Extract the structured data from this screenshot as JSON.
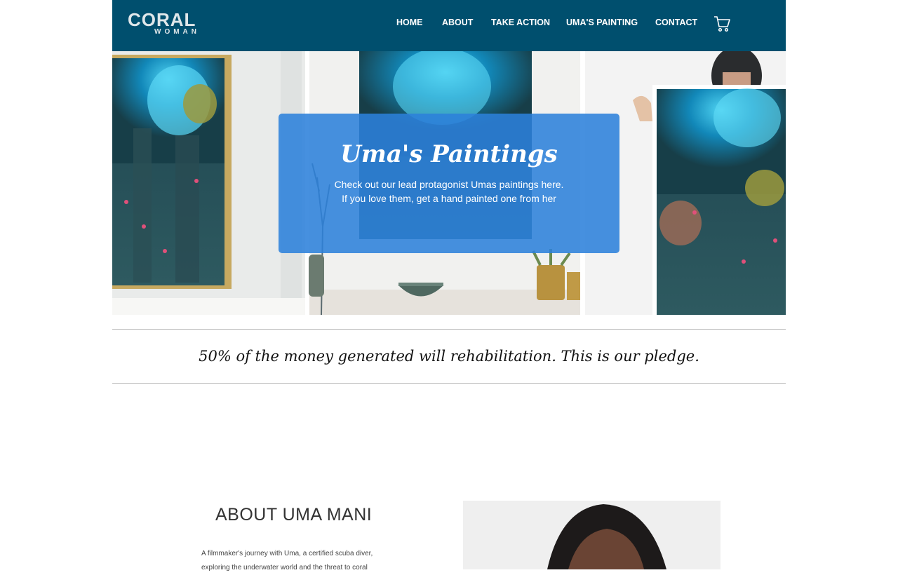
{
  "header": {
    "logo_main": "CORAL",
    "logo_sub": "WOMAN",
    "nav": [
      "HOME",
      "ABOUT",
      "TAKE ACTION",
      "UMA'S PAINTING",
      "CONTACT"
    ],
    "cart_icon": "shopping-cart-icon",
    "background": "#004f6e"
  },
  "hero": {
    "title": "Uma's Paintings",
    "line1": "Check out our lead protagonist Umas paintings here.",
    "line2": "If you love them, get a hand painted one from her",
    "card_color": "#2c81db"
  },
  "pledge": {
    "text": "50% of the money generated will rehabilitation. This is our pledge."
  },
  "about": {
    "title": "ABOUT UMA MANI",
    "line1": "A filmmaker's journey with Uma, a certified scuba diver,",
    "line2": "exploring the underwater world and the threat to coral"
  }
}
